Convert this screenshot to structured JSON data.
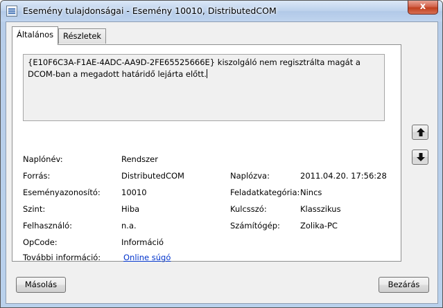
{
  "window": {
    "title": "Esemény tulajdonságai - Esemény 10010, DistributedCOM",
    "close_glyph": "x"
  },
  "tabs": [
    {
      "label": "Általános"
    },
    {
      "label": "Részletek"
    }
  ],
  "description": "{E10F6C3A-F1AE-4ADC-AA9D-2FE65525666E} kiszolgáló nem regisztrálta magát a DCOM-ban a megadott határidő lejárta előtt.",
  "fields": {
    "log_name": {
      "label": "Naplónév:",
      "value": "Rendszer"
    },
    "source": {
      "label": "Forrás:",
      "value": "DistributedCOM"
    },
    "logged": {
      "label": "Naplózva:",
      "value": "2011.04.20. 17:56:28"
    },
    "event_id": {
      "label": "Eseményazonosító:",
      "value": "10010"
    },
    "task_category": {
      "label": "Feladatkategória:",
      "value": "Nincs"
    },
    "level": {
      "label": "Szint:",
      "value": "Hiba"
    },
    "keywords": {
      "label": "Kulcsszó:",
      "value": "Klasszikus"
    },
    "user": {
      "label": "Felhasználó:",
      "value": "n.a."
    },
    "computer": {
      "label": "Számítógép:",
      "value": "Zolika-PC"
    },
    "opcode": {
      "label": "OpCode:",
      "value": "Információ"
    },
    "more_info": {
      "label": "További információ:",
      "value": "Online súgó"
    }
  },
  "buttons": {
    "copy": "Másolás",
    "close": "Bezárás"
  },
  "icons": {
    "up": "arrow-up-icon",
    "down": "arrow-down-icon"
  }
}
